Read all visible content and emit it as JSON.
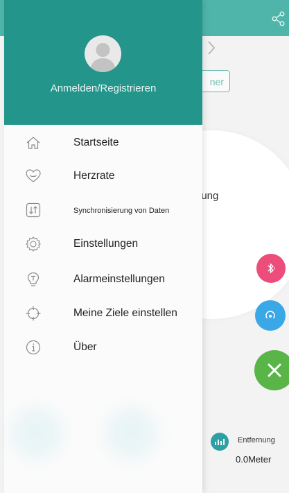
{
  "header": {
    "login_label": "Anmelden/Registrieren"
  },
  "menu": {
    "items": [
      {
        "label": "Startseite",
        "icon": "home-icon"
      },
      {
        "label": "Herzrate",
        "icon": "heart-icon"
      },
      {
        "label": "Synchronisierung von Daten",
        "icon": "sync-icon"
      },
      {
        "label": "Einstellungen",
        "icon": "settings-icon"
      },
      {
        "label": "Alarmeinstellungen",
        "icon": "alarm-icon"
      },
      {
        "label": "Meine Ziele einstellen",
        "icon": "target-icon"
      },
      {
        "label": "Über",
        "icon": "info-icon"
      }
    ]
  },
  "background": {
    "button_partial": "ner",
    "circle_text_partial": "hung",
    "distance_label": "Entfernung",
    "distance_value": "0.0Meter"
  },
  "colors": {
    "header_teal": "#23958a",
    "topbar_teal": "#4fb5aa",
    "bluetooth_pink": "#ec4d7a",
    "signal_blue": "#3aa7e6",
    "close_green": "#59b547"
  }
}
